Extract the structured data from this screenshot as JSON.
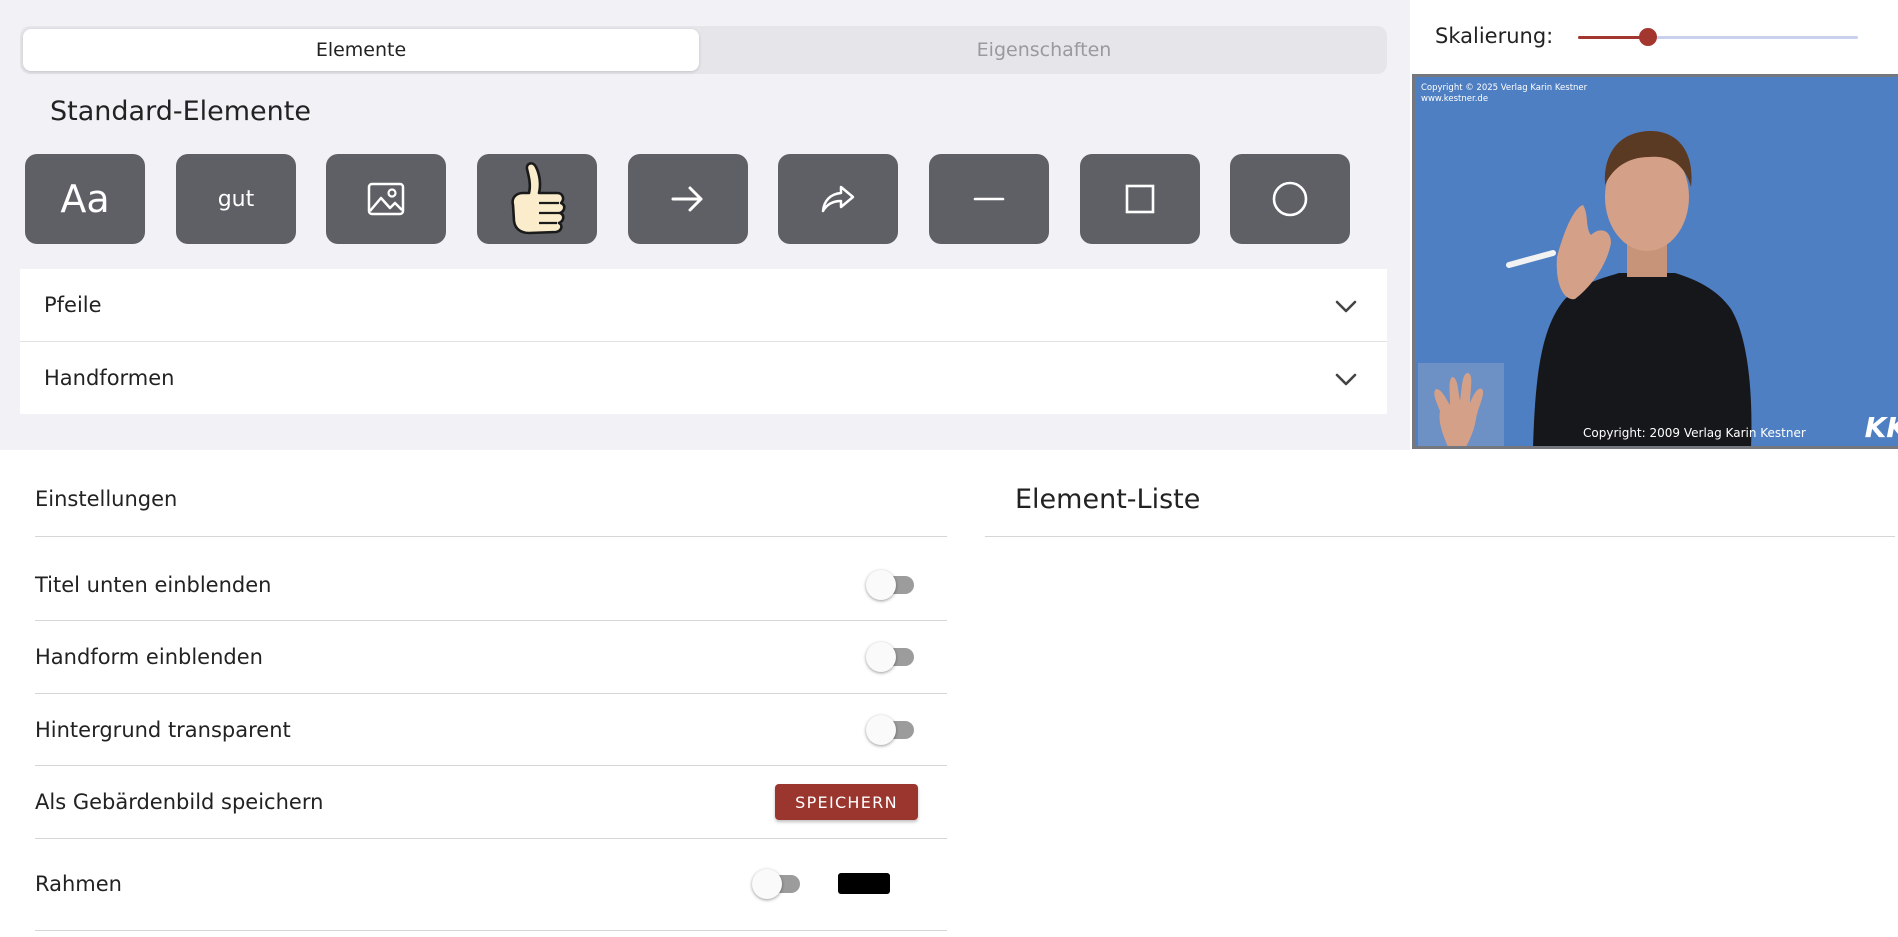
{
  "tabs": [
    {
      "label": "Elemente",
      "active": true
    },
    {
      "label": "Eigenschaften",
      "active": false
    }
  ],
  "standard": {
    "title": "Standard-Elemente",
    "buttons": [
      {
        "name": "text-element-button",
        "label": "Aa",
        "icon": "text-icon"
      },
      {
        "name": "gloss-element-button",
        "label": "gut",
        "icon": "gloss-icon"
      },
      {
        "name": "image-element-button",
        "label": "",
        "icon": "image-icon"
      },
      {
        "name": "thumbs-up-element-button",
        "label": "",
        "icon": "thumbs-up-icon"
      },
      {
        "name": "arrow-element-button",
        "label": "",
        "icon": "arrow-right-icon"
      },
      {
        "name": "curved-arrow-element-button",
        "label": "",
        "icon": "curved-arrow-icon"
      },
      {
        "name": "line-element-button",
        "label": "",
        "icon": "line-icon"
      },
      {
        "name": "square-element-button",
        "label": "",
        "icon": "square-icon"
      },
      {
        "name": "circle-element-button",
        "label": "",
        "icon": "circle-icon"
      }
    ]
  },
  "accordions": [
    {
      "label": "Pfeile",
      "icon": "chevron-down-icon"
    },
    {
      "label": "Handformen",
      "icon": "chevron-down-icon"
    }
  ],
  "scaling": {
    "label": "Skalierung:",
    "value_fraction": 0.25
  },
  "video": {
    "copyright_top": "Copyright © 2025 Verlag Karin Kestner\nwww.kestner.de",
    "copyright_bottom": "Copyright: 2009 Verlag Karin Kestner",
    "logo_text": "KK"
  },
  "settings": {
    "title": "Einstellungen",
    "rows": [
      {
        "label": "Titel unten einblenden",
        "toggle_on": false
      },
      {
        "label": "Handform einblenden",
        "toggle_on": false
      },
      {
        "label": "Hintergrund transparent",
        "toggle_on": false
      },
      {
        "label": "Als Gebärdenbild speichern",
        "button": "SPEICHERN"
      },
      {
        "label": "Rahmen",
        "toggle_on": false,
        "color": "#000000"
      }
    ]
  },
  "element_list": {
    "title": "Element-Liste"
  },
  "colors": {
    "accent": "#9a362e",
    "button_bg": "#5f6066",
    "slider_track": "#c9d0ee",
    "video_bg": "#4f7fc3"
  }
}
